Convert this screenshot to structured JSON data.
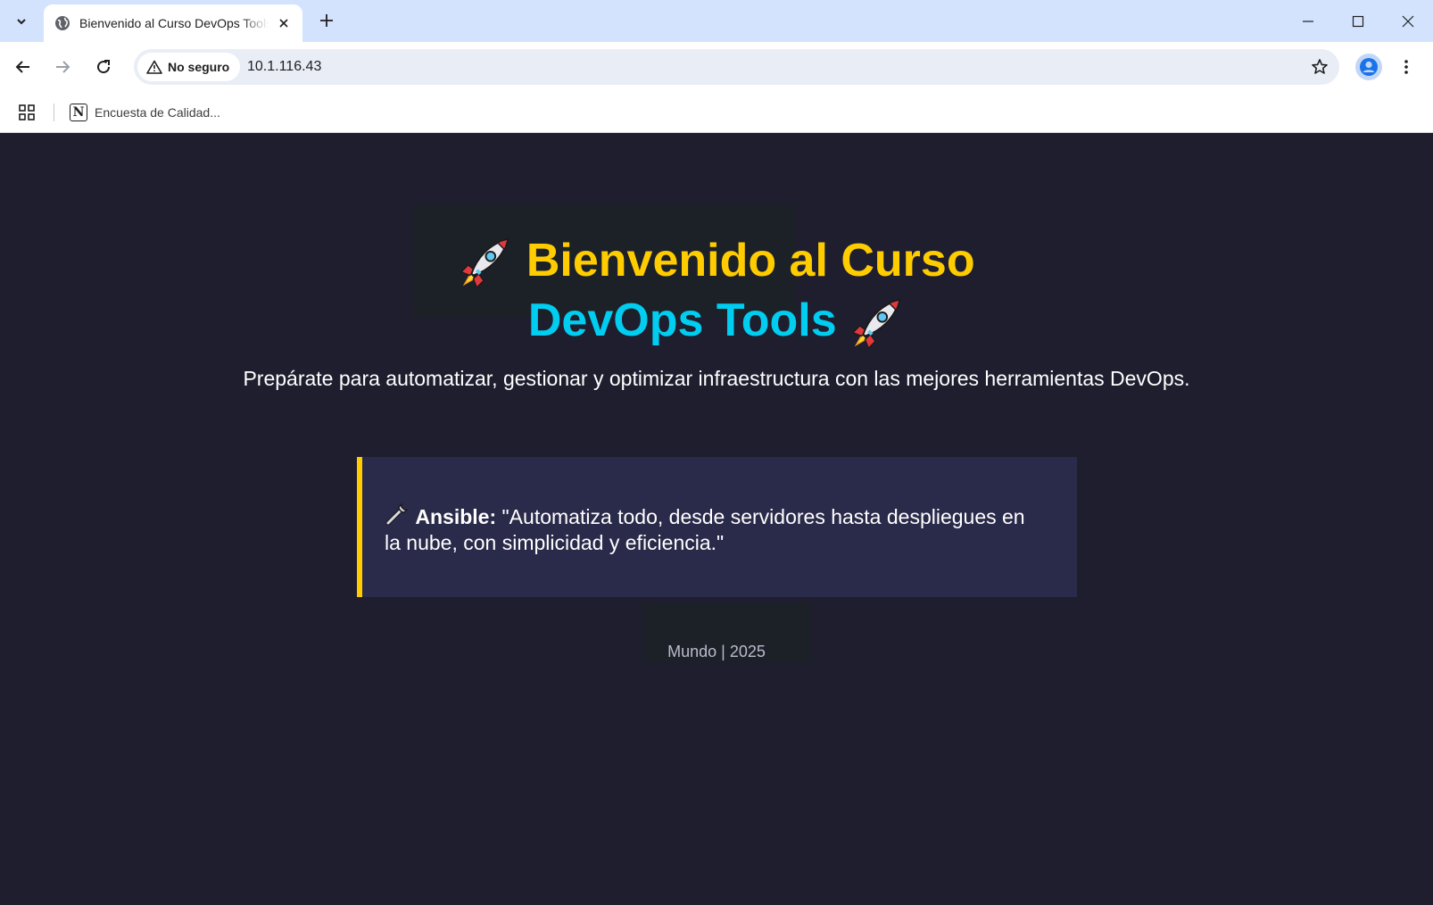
{
  "browser": {
    "tab": {
      "title": "Bienvenido al Curso DevOps Tools",
      "favicon": "globe-icon"
    },
    "address": {
      "security_label": "No seguro",
      "url": "10.1.116.43"
    },
    "bookmarks": [
      {
        "label": "Encuesta de Calidad...",
        "icon": "notion-icon"
      }
    ]
  },
  "page": {
    "title_line1": "Bienvenido al Curso",
    "title_line2": "DevOps Tools",
    "subtitle": "Prepárate para automatizar, gestionar y optimizar infraestructura con las mejores herramientas DevOps.",
    "quote": {
      "tool": "Ansible:",
      "text": "\"Automatiza todo, desde servidores hasta despliegues en la nube, con simplicidad y eficiencia.\""
    },
    "footer": "Mundo | 2025"
  },
  "colors": {
    "background": "#1e1e2e",
    "title_yellow": "#ffcc00",
    "title_cyan": "#00cdf0",
    "card_background": "#2a2a4a",
    "card_accent": "#ffcc00"
  }
}
